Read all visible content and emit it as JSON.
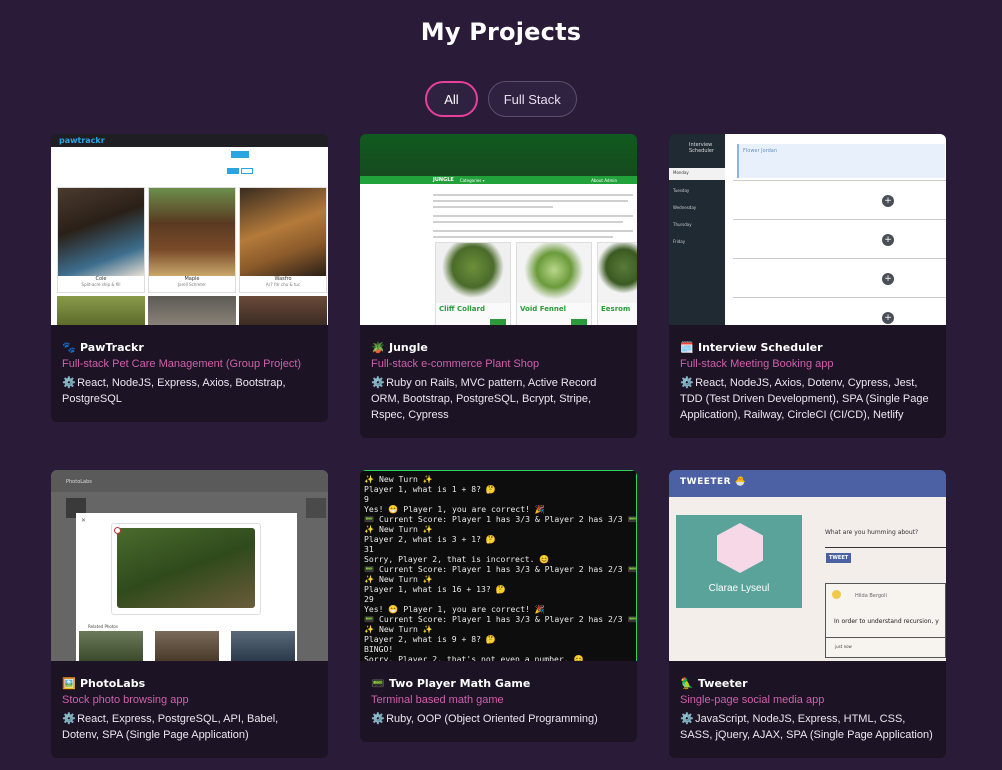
{
  "page": {
    "title": "My Projects"
  },
  "filters": [
    {
      "label": "All",
      "active": true
    },
    {
      "label": "Full Stack",
      "active": false
    }
  ],
  "projects": [
    {
      "emoji": "🐾",
      "title": "PawTrackr",
      "subtitle": "Full-stack Pet Care Management (Group Project)",
      "tech_icon": "⚙️",
      "tech": "React, NodeJS, Express, Axios, Bootstrap, PostgreSQL"
    },
    {
      "emoji": "🪴",
      "title": "Jungle",
      "subtitle": "Full-stack e-commerce Plant Shop",
      "tech_icon": "⚙️",
      "tech": "Ruby on Rails, MVC pattern, Active Record ORM, Bootstrap, PostgreSQL, Bcrypt, Stripe, Rspec, Cypress"
    },
    {
      "emoji": "🗓️",
      "title": "Interview Scheduler",
      "subtitle": "Full-stack Meeting Booking app",
      "tech_icon": "⚙️",
      "tech": "React, NodeJS, Axios, Dotenv, Cypress, Jest, TDD (Test Driven Development), SPA (Single Page Application), Railway, CircleCI (CI/CD), Netlify"
    },
    {
      "emoji": "🖼️",
      "title": "PhotoLabs",
      "subtitle": "Stock photo browsing app",
      "tech_icon": "⚙️",
      "tech": "React, Express, PostgreSQL, API, Babel, Dotenv, SPA (Single Page Application)"
    },
    {
      "emoji": "📟",
      "title": "Two Player Math Game",
      "subtitle": "Terminal based math game",
      "tech_icon": "⚙️",
      "tech": "Ruby, OOP (Object Oriented Programming)"
    },
    {
      "emoji": "🦜",
      "title": "Tweeter",
      "subtitle": "Single-page social media app",
      "tech_icon": "⚙️",
      "tech": "JavaScript, NodeJS, Express, HTML, CSS, SASS, jQuery, AJAX, SPA (Single Page Application)"
    }
  ],
  "thumbs": {
    "pawtrackr": {
      "logo": "pawtrackr",
      "pets": [
        {
          "name": "Cole",
          "breed": "Split-acre ship & fill"
        },
        {
          "name": "Maple",
          "breed": "Jareil Schreter"
        },
        {
          "name": "Wasfro",
          "breed": "Ar7 fdr chu & tuc"
        }
      ]
    },
    "jungle": {
      "brand": "JUNGLE",
      "menu": "Categories ▾",
      "nav": "About  Admin",
      "items": [
        {
          "name": "Cliff Collard",
          "price": "$79.00"
        },
        {
          "name": "Void Fennel",
          "price": "$87.00"
        },
        {
          "name": "Eesrom",
          "price": ""
        }
      ]
    },
    "scheduler": {
      "app": "Interview Scheduler",
      "days": [
        "Monday",
        "Tuesday",
        "Wednesday",
        "Thursday",
        "Friday"
      ],
      "slot_name": "Flower Jordan"
    },
    "photolabs": {
      "brand": "PhotoLabs",
      "related": "Related Photos"
    },
    "math_terminal": [
      "✨ New Turn ✨",
      "Player 1, what is 1 + 8? 🤔",
      "9",
      "Yes! 😁 Player 1, you are correct! 🎉",
      "📟 Current Score: Player 1 has 3/3 & Player 2 has 3/3 📟",
      "✨ New Turn ✨",
      "Player 2, what is 3 + 1? 🤔",
      "31",
      "Sorry, Player 2, that is incorrect. 😊",
      "📟 Current Score: Player 1 has 3/3 & Player 2 has 2/3 📟",
      "✨ New Turn ✨",
      "Player 1, what is 16 + 13? 🤔",
      "29",
      "Yes! 😁 Player 1, you are correct! 🎉",
      "📟 Current Score: Player 1 has 3/3 & Player 2 has 2/3 📟",
      "✨ New Turn ✨",
      "Player 2, what is 9 + 8? 🤔",
      "BINGO!",
      "Sorry, Player 2, that's not even a number. 😊"
    ],
    "tweeter": {
      "brand": "TWEETER 🐣",
      "profile_name": "Clarae Lyseul",
      "prompt": "What are you humming about?",
      "tweet_button": "TWEET",
      "author": "Hilda Bergoli",
      "tweet_text": "In order to understand recursion, y",
      "time": "just now"
    }
  },
  "colors": {
    "background": "#2a1b38",
    "card": "#1c1424",
    "accent_pink": "#e8409a",
    "subtitle": "#d05fae"
  }
}
